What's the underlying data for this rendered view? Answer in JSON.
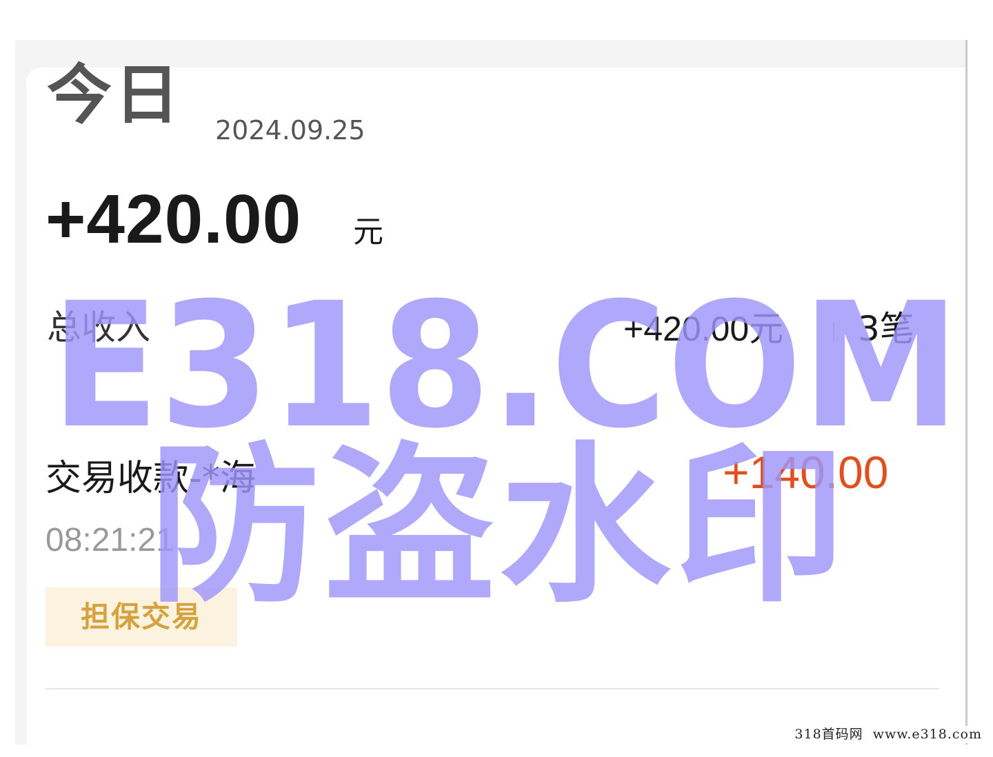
{
  "summary": {
    "day_label": "今日",
    "date": "2024.09.25",
    "net_amount": "+420.00",
    "net_unit": "元",
    "total_income_label": "总收入",
    "total_income_amount": "+420.00元",
    "total_income_count": "3笔"
  },
  "transaction": {
    "title": "交易收款-*海",
    "amount": "+140.00",
    "time": "08:21:21",
    "badge": "担保交易"
  },
  "watermark": {
    "line1": "E318.COM",
    "line2": "防盗水印",
    "footer": "318首码网  www.e318.com"
  },
  "colors": {
    "income_amount": "#e0501f",
    "badge_text": "#d6a23e",
    "badge_background": "#fbf2df",
    "watermark": "#9f97fb"
  }
}
